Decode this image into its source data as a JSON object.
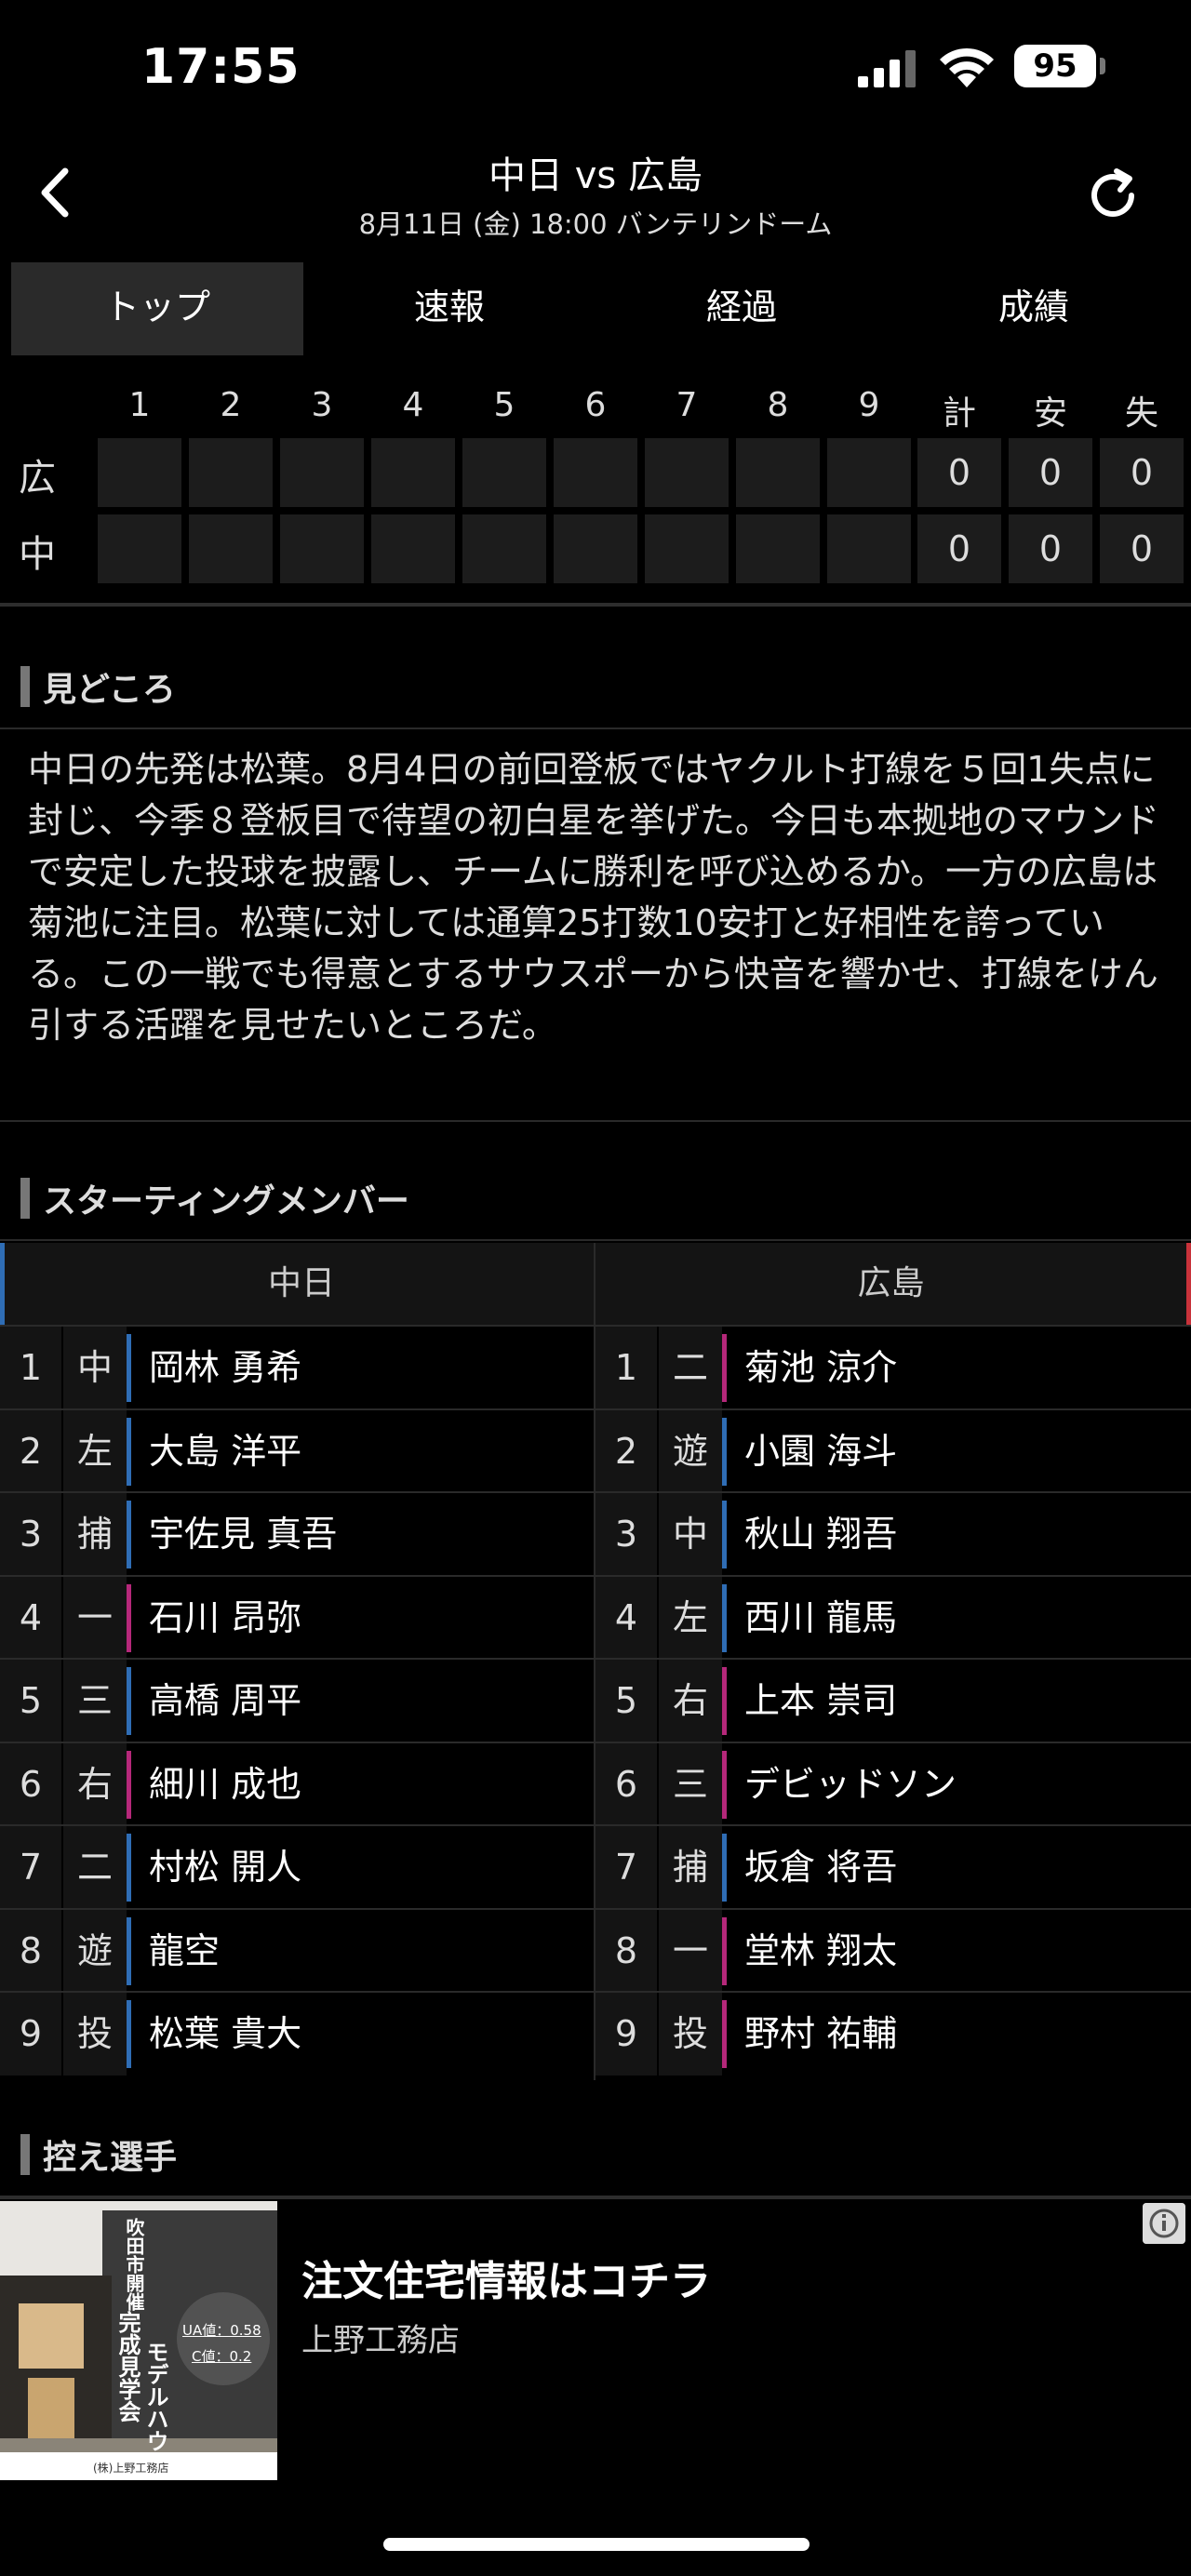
{
  "status": {
    "time": "17:55",
    "battery": "95"
  },
  "header": {
    "title": "中日 vs 広島",
    "subtitle": "8月11日 (金) 18:00 バンテリンドーム"
  },
  "tabs": [
    {
      "label": "トップ",
      "active": true
    },
    {
      "label": "速報"
    },
    {
      "label": "経過"
    },
    {
      "label": "成績"
    }
  ],
  "scoreboard": {
    "headers": [
      "1",
      "2",
      "3",
      "4",
      "5",
      "6",
      "7",
      "8",
      "9",
      "計",
      "安",
      "失"
    ],
    "rows": [
      {
        "team": "広",
        "innings": [
          "",
          "",
          "",
          "",
          "",
          "",
          "",
          "",
          ""
        ],
        "totals": [
          "0",
          "0",
          "0"
        ]
      },
      {
        "team": "中",
        "innings": [
          "",
          "",
          "",
          "",
          "",
          "",
          "",
          "",
          ""
        ],
        "totals": [
          "0",
          "0",
          "0"
        ]
      }
    ]
  },
  "highlights": {
    "heading": "見どころ",
    "text": "中日の先発は松葉。8月4日の前回登板ではヤクルト打線を５回1失点に封じ、今季８登板目で待望の初白星を挙げた。今日も本拠地のマウンドで安定した投球を披露し、チームに勝利を呼び込めるか。一方の広島は菊池に注目。松葉に対しては通算25打数10安打と好相性を誇っている。この一戦でも得意とするサウスポーから快音を響かせ、打線をけん引する活躍を見せたいところだ。"
  },
  "lineup": {
    "heading": "スターティングメンバー",
    "home": {
      "name": "中日",
      "accent": "#2f6db5",
      "players": [
        {
          "num": "1",
          "pos": "中",
          "name": "岡林 勇希",
          "hand": "L"
        },
        {
          "num": "2",
          "pos": "左",
          "name": "大島 洋平",
          "hand": "L"
        },
        {
          "num": "3",
          "pos": "捕",
          "name": "宇佐見 真吾",
          "hand": "L"
        },
        {
          "num": "4",
          "pos": "一",
          "name": "石川 昂弥",
          "hand": "R"
        },
        {
          "num": "5",
          "pos": "三",
          "name": "高橋 周平",
          "hand": "L"
        },
        {
          "num": "6",
          "pos": "右",
          "name": "細川 成也",
          "hand": "R"
        },
        {
          "num": "7",
          "pos": "二",
          "name": "村松 開人",
          "hand": "L"
        },
        {
          "num": "8",
          "pos": "遊",
          "name": "龍空",
          "hand": "L"
        },
        {
          "num": "9",
          "pos": "投",
          "name": "松葉 貴大",
          "hand": "L"
        }
      ]
    },
    "away": {
      "name": "広島",
      "accent": "#c8323a",
      "players": [
        {
          "num": "1",
          "pos": "二",
          "name": "菊池 涼介",
          "hand": "R"
        },
        {
          "num": "2",
          "pos": "遊",
          "name": "小園 海斗",
          "hand": "L"
        },
        {
          "num": "3",
          "pos": "中",
          "name": "秋山 翔吾",
          "hand": "L"
        },
        {
          "num": "4",
          "pos": "左",
          "name": "西川 龍馬",
          "hand": "L"
        },
        {
          "num": "5",
          "pos": "右",
          "name": "上本 崇司",
          "hand": "R"
        },
        {
          "num": "6",
          "pos": "三",
          "name": "デビッドソン",
          "hand": "R"
        },
        {
          "num": "7",
          "pos": "捕",
          "name": "坂倉 将吾",
          "hand": "L"
        },
        {
          "num": "8",
          "pos": "一",
          "name": "堂林 翔太",
          "hand": "R"
        },
        {
          "num": "9",
          "pos": "投",
          "name": "野村 祐輔",
          "hand": "R"
        }
      ]
    },
    "hand_colors": {
      "L": "#2f6db5",
      "R": "#b5287a"
    }
  },
  "bench": {
    "heading": "控え選手"
  },
  "ad": {
    "title": "注文住宅情報はコチラ",
    "advertiser": "上野工務店",
    "banner_text_1": "吹田市開催",
    "banner_text_2": "モデルハウス",
    "banner_text_3": "完成見学会",
    "badge_1": "UA値：0.58",
    "badge_2": "C値：0.2",
    "footer": "(株)上野工務店"
  }
}
